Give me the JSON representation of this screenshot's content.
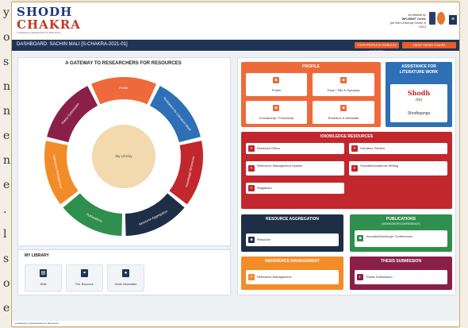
{
  "background_text": [
    "y",
    "o",
    "s",
    "n",
    "n",
    "e",
    "n",
    "e",
    ".",
    "l",
    "s",
    "o",
    "e"
  ],
  "header": {
    "logo_top": "SHODH",
    "logo_bottom": "CHAKRA",
    "logo_tagline": "A Gateway to Researchers for Resources",
    "initiative": [
      "An initiative by",
      "INFLIBNET Centre",
      "(An Inter-University Centre of UGC)"
    ],
    "menu_icon": "hamburger-icon"
  },
  "topbar": {
    "dashboard": "DASHBOARD: SACHIN MALI [S-CHAKRA-2021-01]",
    "buttons": [
      "YOUR PROFILE IS VISIBLE BY INVITATION",
      "ABOUT SHODH CHAKRA"
    ]
  },
  "gateway": {
    "title": "A GATEWAY TO RESEARCHERS FOR RESOURCES",
    "center": "My Library",
    "segments": [
      {
        "label": "Profile",
        "color": "#ef6a3a"
      },
      {
        "label": "Assistance for Literature Work",
        "color": "#2f6fb5"
      },
      {
        "label": "Knowledge Resources",
        "color": "#c1272d"
      },
      {
        "label": "Resource Aggregation",
        "color": "#1f2e47"
      },
      {
        "label": "Publications",
        "color": "#2f8f4e"
      },
      {
        "label": "Reference Management",
        "color": "#f28c28"
      },
      {
        "label": "Thesis Submission",
        "color": "#8a2048"
      }
    ]
  },
  "my_library": {
    "title": "MY LIBRARY",
    "items": [
      {
        "label": "Write",
        "icon": "file-icon"
      },
      {
        "label": "Fav. Resource",
        "icon": "link-icon"
      },
      {
        "label": "Guide Information",
        "icon": "user-icon"
      }
    ]
  },
  "profile": {
    "title": "PROFILE",
    "color": "#ef6a3a",
    "items": [
      "Profile",
      "Topic / Title & Synopsis",
      "Scholarship / Fellowship",
      "Research & Metadata"
    ]
  },
  "assistance": {
    "title": "ASSISTANCE FOR LITERATURE WORK",
    "color": "#2f6fb5",
    "logo_text": "Shodh",
    "logo_sub": "गंगा",
    "link": "Shodhganga"
  },
  "knowledge": {
    "title": "KNOWLEDGE RESOURCES",
    "color": "#c1272d",
    "items": [
      "Research Ethics",
      "Literature Review",
      "Reference Management System",
      "Scientific/Academic Writing",
      "Plagiarism"
    ]
  },
  "aggregation": {
    "title": "RESOURCE AGGREGATION",
    "color": "#1f2e47",
    "items": [
      "Resource"
    ]
  },
  "publications": {
    "title": "PUBLICATIONS",
    "subtitle": "(WORKSHOP/CONFERENCE)",
    "color": "#2f8f4e",
    "items": [
      "Journals/Workshop/ Conferences"
    ]
  },
  "refmgmt": {
    "title": "REFERENCE MANAGEMENT",
    "color": "#f28c28",
    "items": [
      "Reference Management"
    ]
  },
  "thesis": {
    "title": "THESIS SUBMISSION",
    "color": "#8a2048",
    "items": [
      "Thesis Submission"
    ]
  },
  "footer": {
    "text": "A Gateway to Researchers for Resources"
  }
}
